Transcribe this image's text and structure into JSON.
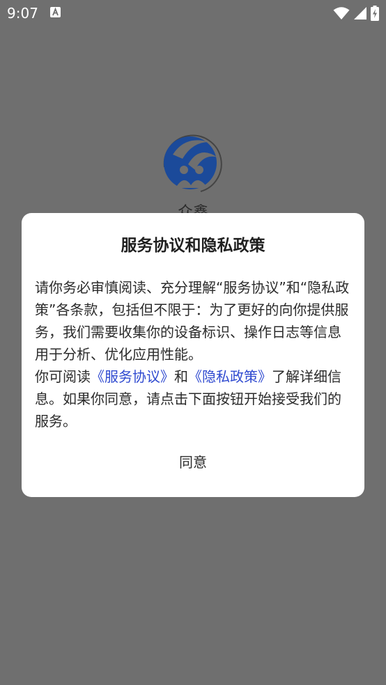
{
  "status_bar": {
    "time": "9:07",
    "icons": [
      "a-notification-icon",
      "wifi-icon",
      "signal-icon",
      "battery-icon"
    ]
  },
  "splash": {
    "app_name": "众鑫",
    "logo_colors": {
      "primary": "#1b4a9a",
      "ring": "#444444"
    }
  },
  "dialog": {
    "title": "服务协议和隐私政策",
    "paragraph1": "请你务必审慎阅读、充分理解“服务协议”和“隐私政策”各条款，包括但不限于：为了更好的向你提供服务，我们需要收集你的设备标识、操作日志等信息用于分析、优化应用性能。",
    "p2_prefix": "你可阅读",
    "service_link": "《服务协议》",
    "p2_and": "和",
    "privacy_link": "《隐私政策》",
    "p2_suffix": "了解详细信息。如果你同意，请点击下面按钮开始接受我们的服务。",
    "agree_label": "同意",
    "link_color": "#2f4ad0"
  },
  "colors": {
    "scrim": "#6f6f6f",
    "dialog_bg": "#ffffff",
    "text": "#2b2b2b"
  }
}
